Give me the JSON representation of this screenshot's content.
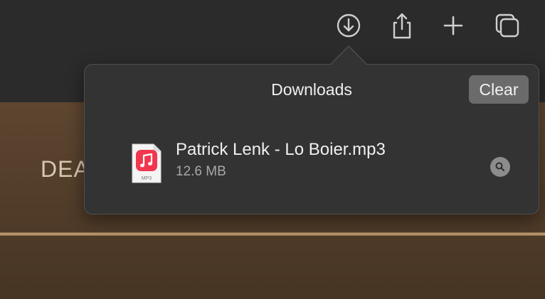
{
  "toolbar": {
    "buttons": [
      {
        "icon": "download-icon"
      },
      {
        "icon": "share-icon"
      },
      {
        "icon": "plus-icon"
      },
      {
        "icon": "tabs-overview-icon"
      }
    ]
  },
  "page": {
    "partial_heading": "DEA"
  },
  "downloads_popover": {
    "title": "Downloads",
    "clear_label": "Clear",
    "items": [
      {
        "name": "Patrick Lenk - Lo Boier.mp3",
        "size": "12.6 MB",
        "file_type_badge": "MP3",
        "icon": "music-file-icon"
      }
    ]
  },
  "colors": {
    "toolbar_bg": "#2b2b2b",
    "popover_bg": "#333333",
    "clear_button_bg": "#6b6b6b",
    "music_icon_red": "#f2364f",
    "page_bg": "#5e4630"
  }
}
